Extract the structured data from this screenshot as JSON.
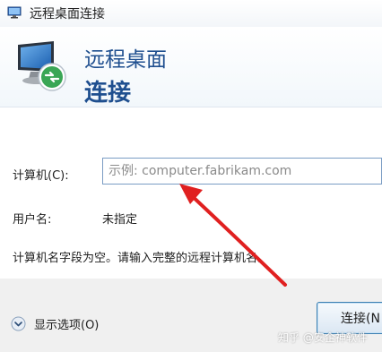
{
  "window": {
    "title": "远程桌面连接",
    "icon": "remote-desktop-icon"
  },
  "header": {
    "line1": "远程桌面",
    "line2": "连接",
    "icon": "monitor-connection-icon"
  },
  "form": {
    "computer_label": "计算机(C):",
    "computer_placeholder": "示例: computer.fabrikam.com",
    "computer_value": "",
    "username_label": "用户名:",
    "username_value": "未指定",
    "message": "计算机名字段为空。请输入完整的远程计算机名。"
  },
  "footer": {
    "options_label": "显示选项(O)",
    "connect_label": "连接(N"
  },
  "watermark": "知乎 @安企神软件",
  "colors": {
    "header_text": "#1f4f8f",
    "arrow": "#e02020",
    "footer_bg": "#f0f0f0"
  }
}
